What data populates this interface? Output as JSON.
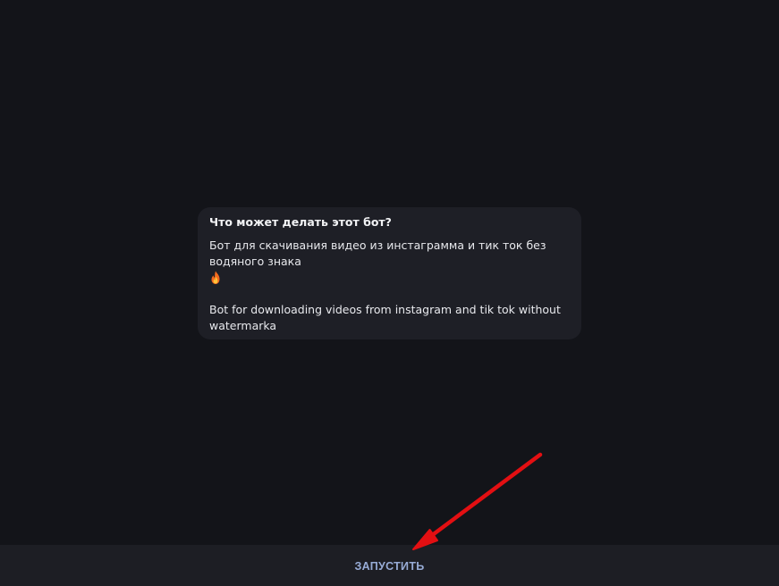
{
  "info_card": {
    "title": "Что может делать этот бот?",
    "line1": "Бот для скачивания видео из инстаграмма и тик ток без",
    "line2": "водяного знака",
    "line3": "Bot for downloading videos from instagram and tik tok without",
    "line4": "watermarka",
    "emoji_icon": "fire-icon"
  },
  "bottom_bar": {
    "start_label": "ЗАПУСТИТЬ"
  },
  "colors": {
    "background": "#131419",
    "card": "#1e1f26",
    "bar": "#1d1e24",
    "button_text": "#98acd6",
    "annotation_arrow": "#e30f12"
  }
}
